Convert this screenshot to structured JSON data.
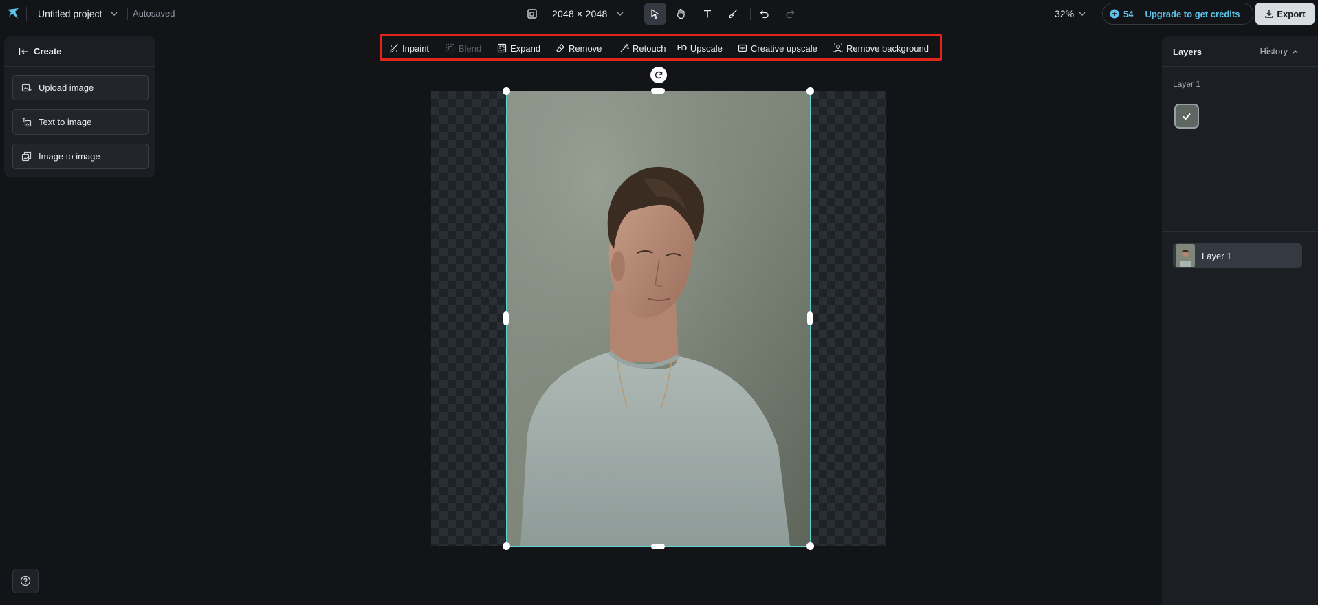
{
  "header": {
    "project_title": "Untitled project",
    "save_status": "Autosaved",
    "canvas_size": "2048 × 2048",
    "zoom": "32%",
    "credits": "54",
    "upgrade_label": "Upgrade to get credits",
    "export_label": "Export",
    "tools": [
      "select",
      "hand",
      "text",
      "brush",
      "undo",
      "redo"
    ],
    "active_tool": "select"
  },
  "left_panel": {
    "title": "Create",
    "items": [
      {
        "label": "Upload image",
        "icon": "upload-image-icon"
      },
      {
        "label": "Text to image",
        "icon": "text-to-image-icon"
      },
      {
        "label": "Image to image",
        "icon": "image-to-image-icon"
      }
    ]
  },
  "edit_toolbar": {
    "items": [
      {
        "label": "Inpaint",
        "icon": "inpaint-icon",
        "enabled": true
      },
      {
        "label": "Blend",
        "icon": "blend-icon",
        "enabled": false
      },
      {
        "label": "Expand",
        "icon": "expand-icon",
        "enabled": true
      },
      {
        "label": "Remove",
        "icon": "eraser-icon",
        "enabled": true
      },
      {
        "label": "Retouch",
        "icon": "retouch-icon",
        "enabled": true
      },
      {
        "label": "Upscale",
        "icon": "hd-icon",
        "enabled": true
      },
      {
        "label": "Creative upscale",
        "icon": "creative-upscale-icon",
        "enabled": true
      },
      {
        "label": "Remove background",
        "icon": "remove-background-icon",
        "enabled": true
      }
    ],
    "highlight_color": "#e0261b"
  },
  "canvas": {
    "selection_color": "#5dd4d0"
  },
  "right_panel": {
    "title": "Layers",
    "history_label": "History",
    "section_label": "Layer 1",
    "layers": [
      {
        "name": "Layer 1"
      }
    ]
  },
  "colors": {
    "accent": "#5cc3e8",
    "background": "#121418",
    "panel": "#1b1e23"
  }
}
